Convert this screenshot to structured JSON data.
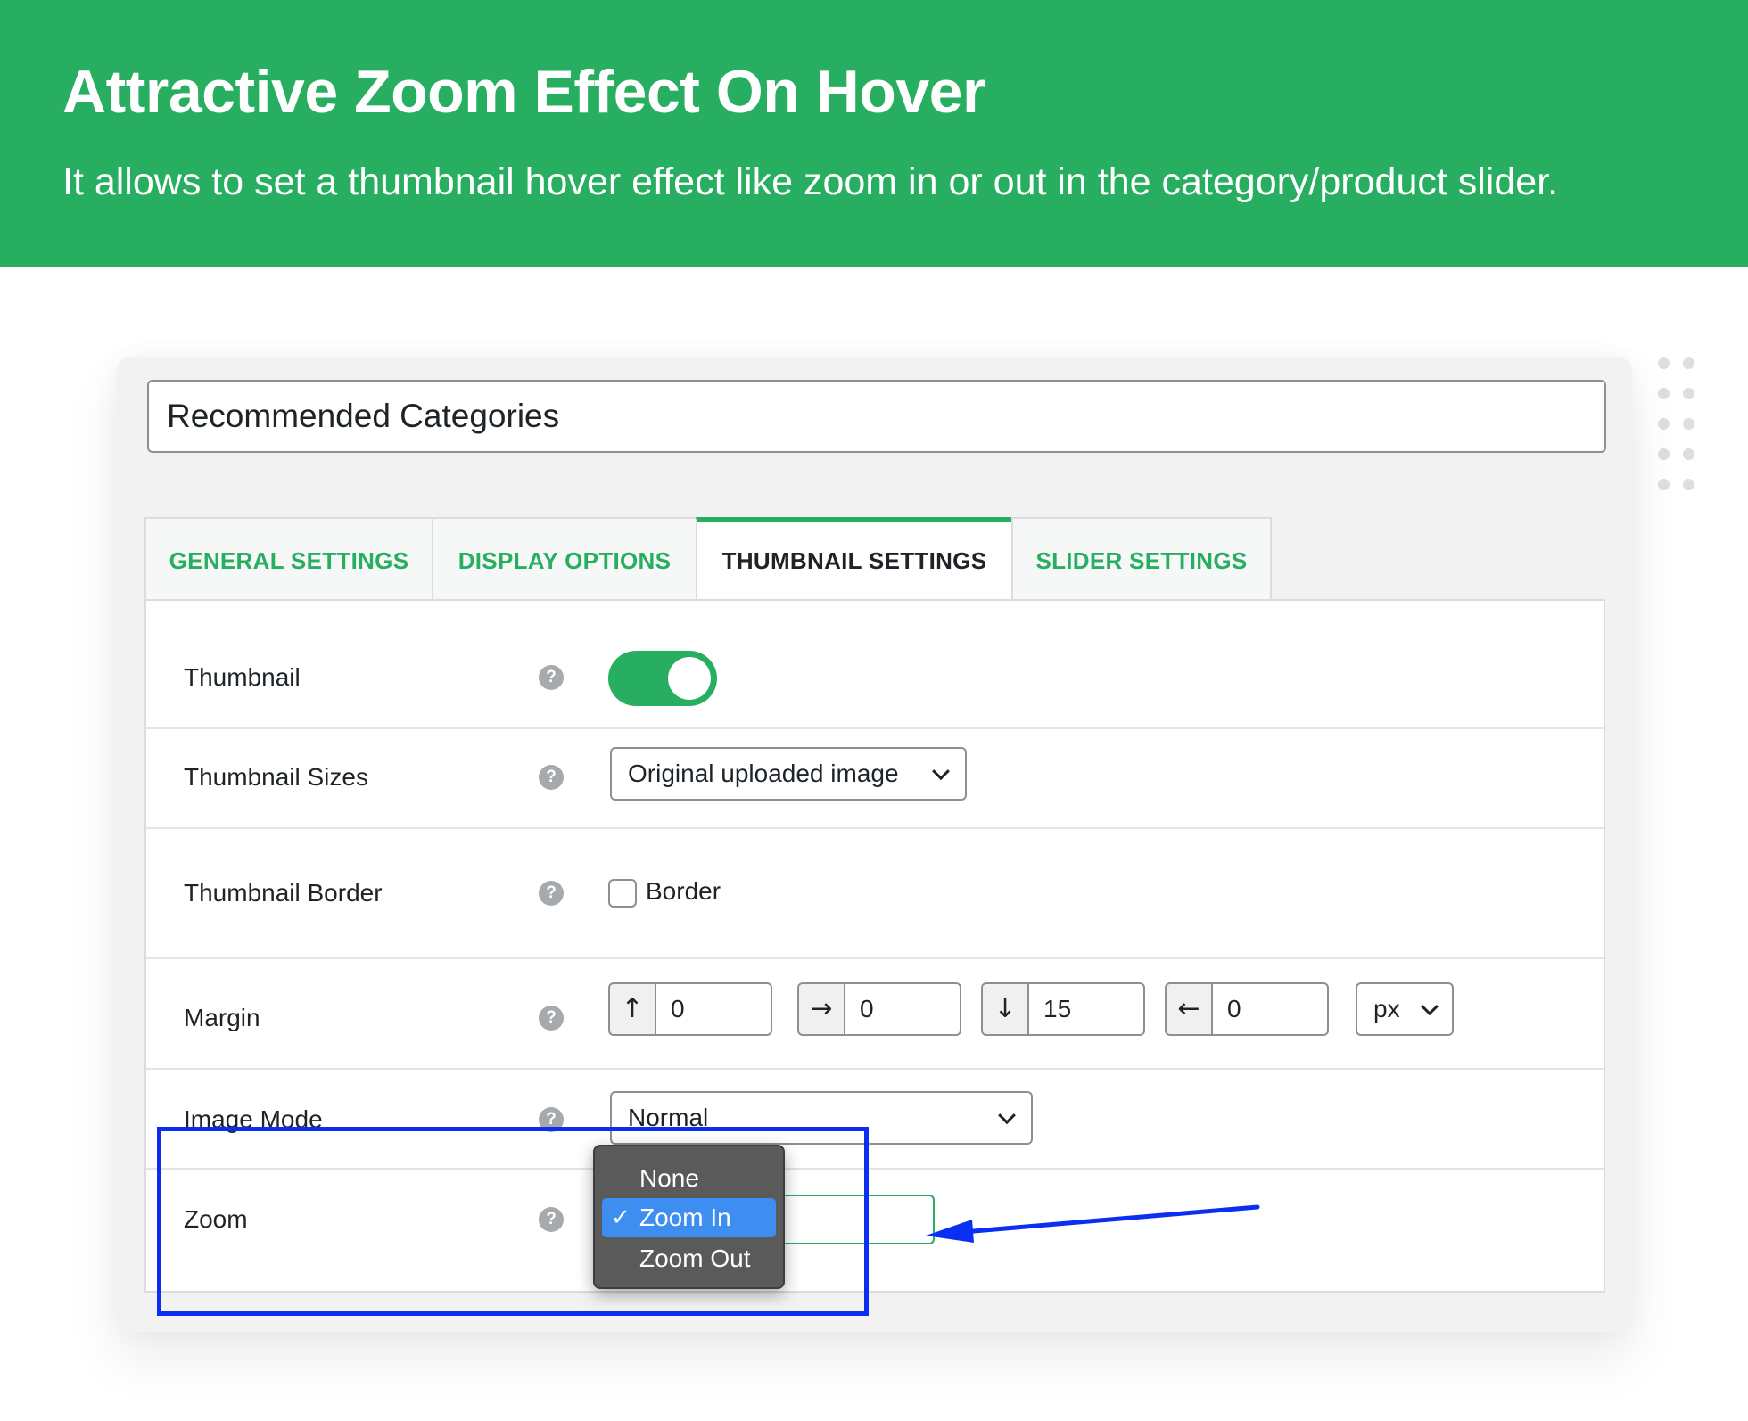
{
  "banner": {
    "title": "Attractive Zoom Effect On Hover",
    "subtitle": "It allows to set a thumbnail hover effect like zoom in or out in the category/product slider."
  },
  "title_field": {
    "value": "Recommended Categories"
  },
  "tabs": [
    {
      "label": "GENERAL SETTINGS",
      "active": false
    },
    {
      "label": "DISPLAY OPTIONS",
      "active": false
    },
    {
      "label": "THUMBNAIL SETTINGS",
      "active": true
    },
    {
      "label": "SLIDER SETTINGS",
      "active": false
    }
  ],
  "rows": {
    "thumbnail": {
      "label": "Thumbnail",
      "toggle_on": true
    },
    "thumbnail_sizes": {
      "label": "Thumbnail Sizes",
      "value": "Original uploaded image"
    },
    "thumbnail_border": {
      "label": "Thumbnail Border",
      "checkbox_label": "Border",
      "checked": false
    },
    "margin": {
      "label": "Margin",
      "top": {
        "icon": "arrow-up-icon",
        "glyph": "↑",
        "value": "0"
      },
      "right": {
        "icon": "arrow-right-icon",
        "glyph": "→",
        "value": "0"
      },
      "bottom": {
        "icon": "arrow-down-icon",
        "glyph": "↓",
        "value": "15"
      },
      "left": {
        "icon": "arrow-left-icon",
        "glyph": "←",
        "value": "0"
      },
      "unit": "px"
    },
    "image_mode": {
      "label": "Image Mode",
      "value": "Normal"
    },
    "zoom": {
      "label": "Zoom",
      "options": [
        "None",
        "Zoom In",
        "Zoom Out"
      ],
      "selected": "Zoom In"
    }
  },
  "help_glyph": "?",
  "check_glyph": "✓",
  "colors": {
    "brand_green": "#28ae60",
    "annotation_blue": "#0a2ff2",
    "dropdown_bg": "#5a5a5a",
    "dropdown_selected": "#3d8ef0"
  }
}
